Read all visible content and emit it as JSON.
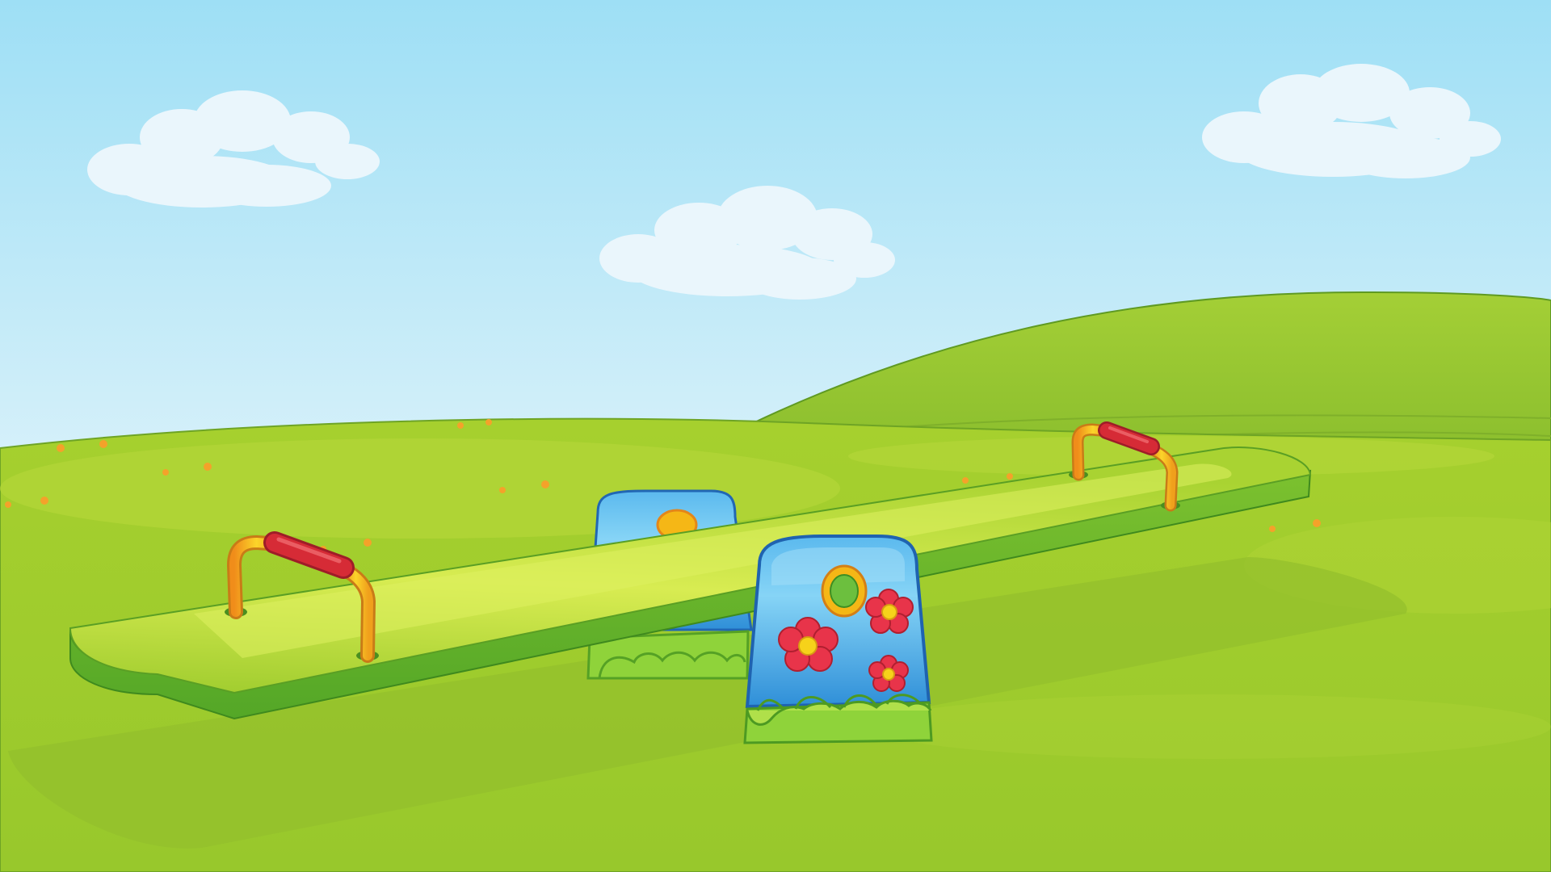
{
  "scene": {
    "subject": "seesaw-playground",
    "colors": {
      "sky_top": "#9edff5",
      "sky_bottom": "#eef8fb",
      "far_hill": "#8ec332",
      "near_meadow": "#a4cf2f",
      "meadow_light": "#c6e04a",
      "plank_top": "#b8dc3c",
      "plank_edge": "#5fb32a",
      "handle_yellow": "#f7c21c",
      "grip_red": "#d62b36",
      "pivot_blue": "#2f8fd8",
      "pivot_light": "#7fd0f4",
      "pivot_base": "#8fd33a",
      "flower_red": "#e8344a",
      "flower_center": "#f6d21a",
      "cloud": "#eaf6fc"
    },
    "icons": [
      "cloud-icon",
      "flower-icon",
      "seesaw-handle-icon"
    ]
  }
}
